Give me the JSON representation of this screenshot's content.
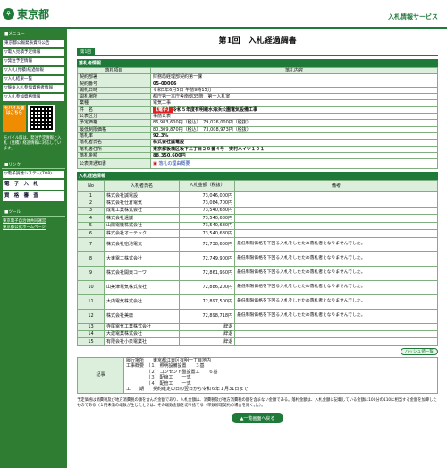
{
  "header": {
    "logo_mark": "⚘",
    "logo_text": "東京都",
    "service_title": "入札情報サービス"
  },
  "sidebar": {
    "menu_title": "■メニュー",
    "items": [
      {
        "label": "東京都公報発表資料公告"
      },
      {
        "label": "▽電入見積予定情報"
      },
      {
        "label": "▽発注予定情報"
      },
      {
        "label": "▽入札(見積)経過情報"
      },
      {
        "label": "▽入札結果一覧"
      },
      {
        "label": "▽競争入札参加資格者情報"
      },
      {
        "label": "▽入札参加資格情報"
      }
    ],
    "mobile_badge": "モバイル版はこちら",
    "mobile_note": "モバイル版は、発注予定情報と入札（見積）経過情報に対応しています。",
    "link_title": "■リンク",
    "links": [
      {
        "label": "▽電子調達システム(TOP)"
      },
      {
        "label": "電　子　入　札"
      },
      {
        "label": "資　格　審　査"
      }
    ],
    "bottom_title": "■ツール",
    "bottom_links": [
      {
        "label": "東京電子自治体共同運営"
      },
      {
        "label": "東京都公式ホームページ"
      }
    ]
  },
  "main": {
    "page_title": "第1回　入札経過調書",
    "tab_label": "第1回",
    "section1_title": "落札者情報",
    "info_header": {
      "item": "落札項目",
      "content": "落札内容"
    },
    "info_rows": [
      {
        "label": "契約部署",
        "value": "財務局経理部契約第一課"
      },
      {
        "label": "契約番号",
        "value": "05-00006"
      },
      {
        "label": "開札日時",
        "value": "令和5年6月5日 午前9時15分"
      },
      {
        "label": "開札場所",
        "value": "都庁第一本庁舎南側35階　第一入札室"
      },
      {
        "label": "業種",
        "value": "電気工事"
      },
      {
        "label": "件　名",
        "tag": "【電子】",
        "value": "令和５年度有明親水海浜公園電気設備工事"
      },
      {
        "label": "公表区分",
        "value": "事前公表"
      },
      {
        "label": "予定価格",
        "value": "86,983,600円（税込）　79,076,000円（税抜）"
      },
      {
        "label": "最低制限価格",
        "value": "80,309,870円（税込）　73,008,973円（税抜）"
      },
      {
        "label": "落札率",
        "value": "92.3%"
      },
      {
        "label": "落札者氏名",
        "value": "株式会社誠電設"
      },
      {
        "label": "落札者住所",
        "value": "東京都板橋区坂下三丁目２９番４号　安村ハイツ１０１"
      },
      {
        "label": "落札金額",
        "value": "88,350,600円"
      },
      {
        "label": "公表済通知書",
        "value": "落札の理由概要"
      }
    ],
    "section2_title": "入札経過情報",
    "bid_header": {
      "no": "No",
      "name": "入札者氏名",
      "amount": "入札金額（税抜）",
      "note": "備考"
    },
    "bids": [
      {
        "no": "1",
        "name": "株式会社誠電設",
        "amount": "73,046,000円",
        "note": ""
      },
      {
        "no": "2",
        "name": "株式会社仕倉電気",
        "amount": "73,084,700円",
        "note": ""
      },
      {
        "no": "3",
        "name": "成電工業株式会社",
        "amount": "73,540,680円",
        "note": ""
      },
      {
        "no": "4",
        "name": "株式会社遠誠",
        "amount": "73,540,680円",
        "note": ""
      },
      {
        "no": "5",
        "name": "山陽電機株式会社",
        "amount": "73,540,680円",
        "note": ""
      },
      {
        "no": "6",
        "name": "株式会社オーテック",
        "amount": "73,540,680円",
        "note": ""
      },
      {
        "no": "7",
        "name": "株式会社宿池電気",
        "amount": "72,738,600円",
        "note": "最低制限価格を下回る入札をしたため落札者となりませんでした。"
      },
      {
        "no": "8",
        "name": "大東電工株式会社",
        "amount": "72,749,900円",
        "note": "最低制限価格を下回る入札をしたため落札者となりませんでした。"
      },
      {
        "no": "9",
        "name": "株式会社開東コーワ",
        "amount": "72,861,950円",
        "note": "最低制限価格を下回る入札をしたため落札者となりませんでした。"
      },
      {
        "no": "10",
        "name": "山美津電気株式会社",
        "amount": "72,886,200円",
        "note": "最低制限価格を下回る入札をしたため落札者となりませんでした。"
      },
      {
        "no": "11",
        "name": "大内電気株式会社",
        "amount": "72,897,500円",
        "note": "最低制限価格を下回る入札をしたため落札者となりませんでした。"
      },
      {
        "no": "12",
        "name": "株式会社美庸",
        "amount": "72,898,718円",
        "note": "最低制限価格を下回る入札をしたため落札者となりませんでした。"
      },
      {
        "no": "13",
        "name": "寺尾電気工業株式会社",
        "amount": "辞退",
        "note": ""
      },
      {
        "no": "14",
        "name": "大建電業株式会社",
        "amount": "辞退",
        "note": ""
      },
      {
        "no": "15",
        "name": "有限会社小泉電業社",
        "amount": "辞退",
        "note": ""
      }
    ],
    "hash_button": "ハッシュ値一覧",
    "remarks_label": "記事",
    "remarks_lines": [
      "履行場所　　東京都江東区有明一丁目地内",
      "工事概要　（１）照明設備設置　　３基",
      "　　　　　（２）コンセント盤設置工　　６基",
      "　　　　　（３）配線工　　一式",
      "　　　　　（４）配管工　　一式",
      "工　　期　　契約確定の日の翌日から令和６年１月31日まで"
    ],
    "footnote": "予定価格は消費税及び地方消費税の額を含んだ金額であり、入札金額は、消費税及び地方消費税の額を含まない金額である。落札金額は、入札金額に記載している金額に100分の110に相当する金額を加算したものである（１円未満の端数が生じたときは、その端数金額を切り捨てる（単数修理契約の場合を除く。）。）。",
    "back_button": "▲一覧画面へ戻る"
  },
  "colors": {
    "accent": "#1f7a3a",
    "sidebar": "#2e7d32",
    "tag_red": "#dd2222",
    "row_label_bg": "#dceedc"
  }
}
